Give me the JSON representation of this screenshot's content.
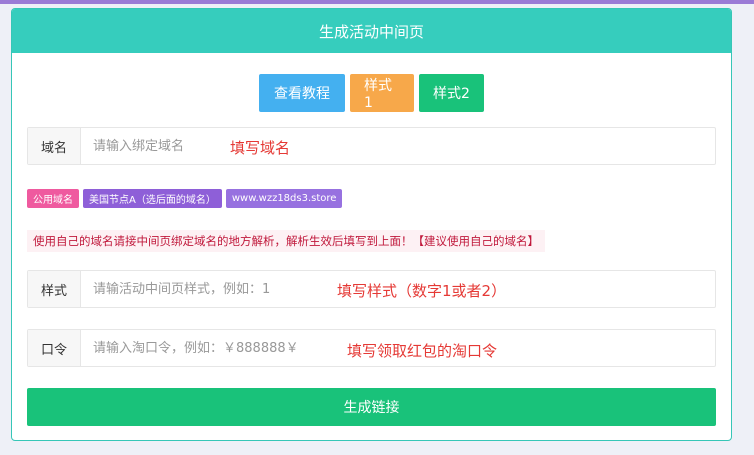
{
  "header": {
    "title": "生成活动中间页"
  },
  "buttons": {
    "tutorial": "查看教程",
    "style1": "样式1",
    "style2": "样式2"
  },
  "domain_field": {
    "label": "域名",
    "placeholder": "请输入绑定域名",
    "hint": "填写域名"
  },
  "tags": {
    "public": "公用域名",
    "node": "美国节点A（选后面的域名）",
    "domain": "www.wzz18ds3.store"
  },
  "notice": "使用自己的域名请接中间页绑定域名的地方解析，解析生效后填写到上面！【建议使用自己的域名】",
  "style_field": {
    "label": "样式",
    "placeholder": "请输活动中间页样式，例如：1",
    "hint": "填写样式（数字1或者2）"
  },
  "token_field": {
    "label": "口令",
    "placeholder": "请输入淘口令，例如：￥888888￥",
    "hint": "填写领取红包的淘口令"
  },
  "submit": {
    "label": "生成链接"
  },
  "colors": {
    "header": "#36cdbd",
    "blue": "#44b0f0",
    "orange": "#f7a84a",
    "green": "#19c27a",
    "hint_red": "#e53935"
  }
}
